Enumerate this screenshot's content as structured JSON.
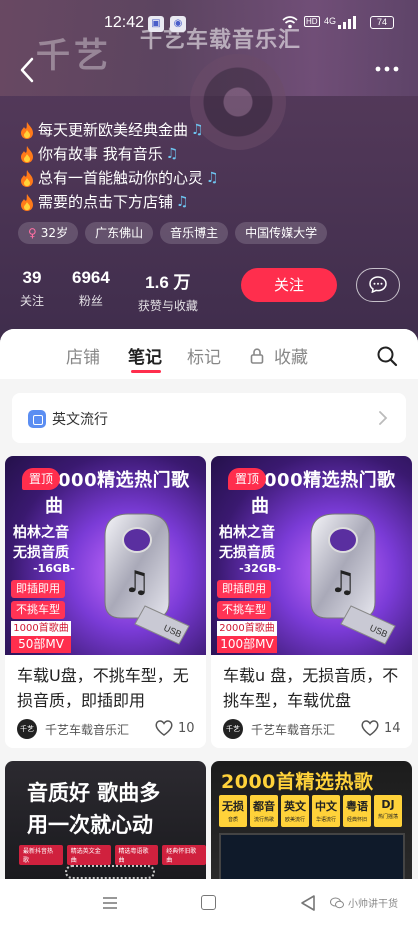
{
  "status_bar": {
    "time": "12:42",
    "hd_label": "HD",
    "net_label": "4G",
    "battery": "74"
  },
  "cover_art": {
    "logo_text": "千艺",
    "shop_name": "千艺车载音乐汇"
  },
  "bio": {
    "lines": [
      "每天更新欧美经典金曲",
      "你有故事 我有音乐",
      "总有一首能触动你的心灵",
      "需要的点击下方店铺"
    ],
    "note_glyph": "♫"
  },
  "tags": [
    {
      "label": "32岁",
      "gender_glyph": "♀"
    },
    {
      "label": "广东佛山"
    },
    {
      "label": "音乐博主"
    },
    {
      "label": "中国传媒大学"
    }
  ],
  "stats": [
    {
      "value": "39",
      "label": "关注"
    },
    {
      "value": "6964",
      "label": "粉丝"
    },
    {
      "value": "1.6 万",
      "label": "获赞与收藏"
    }
  ],
  "actions": {
    "follow": "关注",
    "message_icon": "chat-bubble-icon"
  },
  "tabs": [
    {
      "label": "店铺",
      "active": false
    },
    {
      "label": "笔记",
      "active": true
    },
    {
      "label": "标记",
      "active": false
    },
    {
      "label": "收藏",
      "active": false,
      "locked": true
    }
  ],
  "collection": {
    "label": "英文流行"
  },
  "cards": [
    {
      "pin": "置顶",
      "cover": {
        "headline": "2000精选热门歌曲",
        "line1": "柏林之音",
        "line2": "无损音质",
        "size": "-16GB-",
        "badge1": "即插即用",
        "badge2": "不挑车型",
        "badge3": "1000首歌曲",
        "badge4": "50部MV"
      },
      "title": "车载U盘，不挑车型，无损音质，即插即用",
      "author": "千艺车载音乐汇",
      "avatar_text": "千艺",
      "likes": "10"
    },
    {
      "pin": "置顶",
      "cover": {
        "headline": "2000精选热门歌曲",
        "line1": "柏林之音",
        "line2": "无损音质",
        "size": "-32GB-",
        "badge1": "即插即用",
        "badge2": "不挑车型",
        "badge3": "2000首歌曲",
        "badge4": "100部MV"
      },
      "title": "车载u 盘，无损音质，不挑车型，车载优盘",
      "author": "千艺车载音乐汇",
      "avatar_text": "千艺",
      "likes": "14"
    }
  ],
  "cards_row2": [
    {
      "line1": "音质好 歌曲多",
      "line2": "用一次就心动",
      "chips": [
        "最新抖音热歌",
        "精选英文金曲",
        "精选粤语歌曲",
        "经典怀旧歌曲"
      ]
    },
    {
      "headline": "2000首精选热歌",
      "chips": [
        {
          "label": "无损",
          "sub": "音质"
        },
        {
          "label": "都音",
          "sub": "流行热歌"
        },
        {
          "label": "英文",
          "sub": "欧美流行"
        },
        {
          "label": "中文",
          "sub": "华语流行"
        },
        {
          "label": "粤语",
          "sub": "经典怀旧"
        },
        {
          "label": "DJ",
          "sub": "热门摇荡"
        }
      ]
    }
  ],
  "watermark": {
    "text": "小帅讲干货"
  }
}
